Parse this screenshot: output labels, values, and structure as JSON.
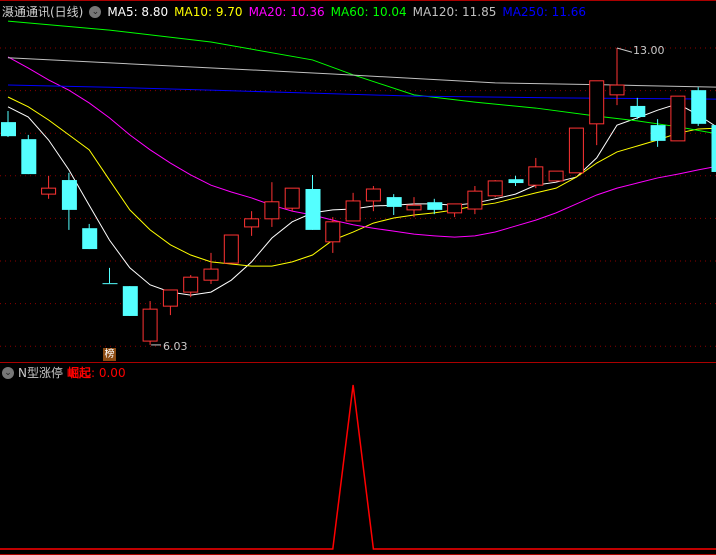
{
  "header": {
    "stock_name": "滠通通讯(日线)",
    "ma": [
      {
        "label": "MA5: 8.80",
        "color": "#ffffff"
      },
      {
        "label": "MA10: 9.70",
        "color": "#ffff00"
      },
      {
        "label": "MA20: 10.36",
        "color": "#ff00ff"
      },
      {
        "label": "MA60: 10.04",
        "color": "#00ff00"
      },
      {
        "label": "MA120: 11.85",
        "color": "#c0c0c0"
      },
      {
        "label": "MA250: 11.66",
        "color": "#0000ff"
      }
    ]
  },
  "indicator": {
    "name": "N型涨停",
    "value_label": "崛起",
    "value": ": 0.00",
    "color": "#ff0000"
  },
  "badge": "榜",
  "annotations": {
    "high": "13.00",
    "low": "6.03"
  },
  "colors": {
    "up": "#ff3333",
    "down": "#54ffff",
    "grid": "#8b0000"
  },
  "chart_data": {
    "type": "candlestick",
    "grid_prices": [
      13,
      12,
      11,
      10,
      9,
      8,
      7,
      6
    ],
    "candles": [
      [
        11.26,
        11.52,
        10.91,
        10.93
      ],
      [
        10.86,
        10.96,
        10.04,
        10.04
      ],
      [
        9.57,
        10.0,
        9.46,
        9.71
      ],
      [
        9.9,
        10.07,
        8.73,
        9.2
      ],
      [
        8.77,
        8.87,
        8.28,
        8.28
      ],
      [
        7.48,
        7.84,
        7.48,
        7.48
      ],
      [
        7.41,
        7.41,
        6.71,
        6.71
      ],
      [
        6.12,
        7.06,
        6.03,
        6.87
      ],
      [
        6.94,
        7.32,
        6.73,
        7.32
      ],
      [
        7.27,
        7.67,
        7.15,
        7.62
      ],
      [
        7.55,
        8.19,
        7.46,
        7.81
      ],
      [
        7.95,
        8.61,
        7.95,
        8.61
      ],
      [
        8.8,
        9.17,
        8.59,
        8.99
      ],
      [
        8.99,
        9.85,
        8.8,
        9.39
      ],
      [
        9.24,
        9.71,
        9.17,
        9.71
      ],
      [
        9.69,
        10.02,
        8.73,
        8.73
      ],
      [
        8.45,
        9.03,
        8.19,
        8.92
      ],
      [
        8.94,
        9.6,
        8.94,
        9.41
      ],
      [
        9.41,
        9.76,
        9.17,
        9.69
      ],
      [
        9.5,
        9.57,
        9.08,
        9.27
      ],
      [
        9.2,
        9.5,
        9.03,
        9.31
      ],
      [
        9.38,
        9.46,
        9.1,
        9.2
      ],
      [
        9.13,
        9.34,
        9.03,
        9.34
      ],
      [
        9.22,
        9.76,
        9.1,
        9.64
      ],
      [
        9.53,
        9.9,
        9.5,
        9.88
      ],
      [
        9.92,
        10.0,
        9.76,
        9.83
      ],
      [
        9.78,
        10.42,
        9.71,
        10.21
      ],
      [
        9.88,
        10.11,
        9.88,
        10.11
      ],
      [
        10.07,
        11.12,
        10.07,
        11.12
      ],
      [
        11.22,
        12.23,
        10.72,
        12.23
      ],
      [
        11.9,
        13.0,
        11.66,
        12.13
      ],
      [
        11.64,
        11.83,
        11.33,
        11.38
      ],
      [
        11.19,
        11.33,
        10.68,
        10.82
      ],
      [
        10.82,
        11.87,
        10.82,
        11.87
      ],
      [
        12.01,
        12.08,
        11.17,
        11.22
      ],
      [
        11.19,
        11.19,
        10.09,
        10.09
      ]
    ],
    "ma_lines": {
      "MA5": [
        11.62,
        11.38,
        10.84,
        10.14,
        9.31,
        8.49,
        7.84,
        7.44,
        7.27,
        7.2,
        7.27,
        7.55,
        7.98,
        8.54,
        8.92,
        9.13,
        9.2,
        9.22,
        9.29,
        9.31,
        9.34,
        9.34,
        9.31,
        9.36,
        9.46,
        9.57,
        9.78,
        9.85,
        9.97,
        10.42,
        11.19,
        11.36,
        11.54,
        11.69,
        11.43,
        11.12
      ],
      "MA10": [
        11.85,
        11.62,
        11.31,
        10.96,
        10.61,
        9.9,
        9.2,
        8.73,
        8.38,
        8.14,
        7.98,
        7.93,
        7.88,
        7.88,
        7.98,
        8.14,
        8.49,
        8.68,
        8.89,
        9.01,
        9.08,
        9.13,
        9.2,
        9.29,
        9.36,
        9.48,
        9.6,
        9.71,
        9.97,
        10.3,
        10.56,
        10.7,
        10.84,
        11.0,
        11.1,
        11.12
      ],
      "MA20": [
        12.79,
        12.53,
        12.25,
        12.01,
        11.71,
        11.36,
        10.96,
        10.61,
        10.3,
        10.02,
        9.78,
        9.62,
        9.48,
        9.31,
        9.17,
        9.08,
        8.96,
        8.85,
        8.77,
        8.7,
        8.63,
        8.59,
        8.56,
        8.59,
        8.68,
        8.82,
        8.96,
        9.13,
        9.34,
        9.55,
        9.71,
        9.83,
        9.95,
        10.04,
        10.14,
        10.23
      ],
      "MA60": [
        [
          0,
          13.63
        ],
        [
          5,
          13.42
        ],
        [
          10,
          13.14
        ],
        [
          15,
          12.72
        ],
        [
          17,
          12.37
        ],
        [
          20,
          11.9
        ],
        [
          23,
          11.73
        ],
        [
          26,
          11.59
        ],
        [
          29,
          11.4
        ],
        [
          31,
          11.29
        ],
        [
          33,
          11.15
        ],
        [
          35,
          10.98
        ]
      ],
      "MA120": [
        [
          0,
          12.77
        ],
        [
          16,
          12.39
        ],
        [
          24,
          12.18
        ],
        [
          30,
          12.13
        ],
        [
          35,
          12.08
        ]
      ],
      "MA250": [
        [
          0,
          12.13
        ],
        [
          5,
          12.08
        ],
        [
          10,
          12.01
        ],
        [
          15,
          11.94
        ],
        [
          20,
          11.87
        ],
        [
          27,
          11.83
        ],
        [
          35,
          11.8
        ]
      ]
    },
    "indicator_values": [
      0,
      0,
      0,
      0,
      0,
      0,
      0,
      0,
      0,
      0,
      0,
      0,
      0,
      0,
      0,
      0,
      0,
      1,
      0,
      0,
      0,
      0,
      0,
      0,
      0,
      0,
      0,
      0,
      0,
      0,
      0,
      0,
      0,
      0,
      0,
      0
    ]
  }
}
